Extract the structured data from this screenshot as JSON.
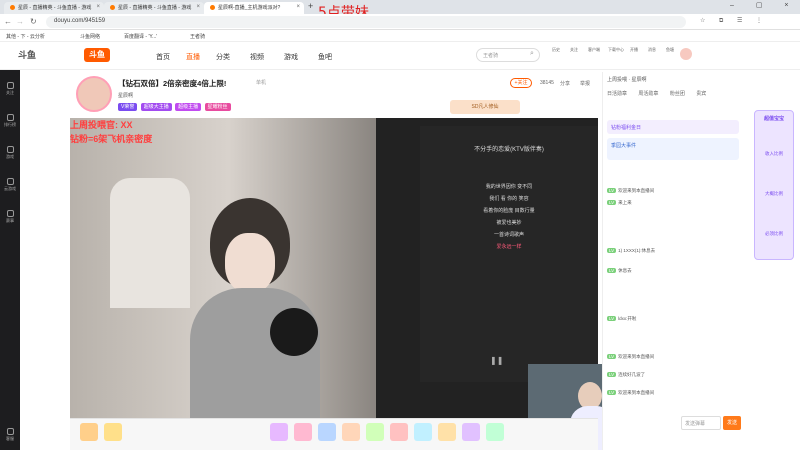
{
  "browser": {
    "tabs": [
      {
        "label": "星辰 - 直播精英 - 斗鱼直播 - 游戏"
      },
      {
        "label": "星辰 - 直播精英 - 斗鱼直播 - 游戏"
      },
      {
        "label": "星辰啊-直播_主机游戏派对?"
      }
    ],
    "url": "douyu.com/945159",
    "bookmarks": [
      "其他 - 下 - 云分析",
      "斗鱼网络",
      "百度翻译 - 'Y...'",
      "王者骑"
    ]
  },
  "overlay_text": "5点带妹",
  "site": {
    "logo": "斗鱼",
    "nav": [
      "首页",
      "直播",
      "分类",
      "视频",
      "游戏",
      "鱼吧"
    ],
    "search_placeholder": "王者骑",
    "header_icons": [
      "历史",
      "关注",
      "客户端",
      "下载中心",
      "开播",
      "消息",
      "鱼塘"
    ]
  },
  "rail": [
    "关注",
    "排行榜",
    "游戏",
    "云游戏",
    "赛事",
    "客服"
  ],
  "room": {
    "title": "【钻石双倍】2倍亲密度4倍上限!",
    "category": "单机",
    "sub": "星辰啊",
    "badges": [
      "V荣誉",
      "超级大主播",
      "超级主播",
      "星耀粉丝"
    ],
    "follow_label": "+关注",
    "fans_count": "38145",
    "share_label": "分享",
    "report_label": "举报",
    "sponsor": "SD凡人修仙"
  },
  "video": {
    "caption1": "上周投喂官: XX",
    "caption2": "钻粉=6架飞机亲密度",
    "music": {
      "title": "不分手的恋爱(KTV版伴奏)",
      "lines": [
        "我的世界因你 变不同",
        "我们 看 你的 笑容",
        "看着你的脸庞 目数行量",
        "被爱也美妙",
        "一首诗词歌声",
        "要永远一样"
      ],
      "active_line": "爱永远一样"
    }
  },
  "right_panel": {
    "tabs": [
      "日活勋章",
      "周活勋章",
      "粉丝团",
      "贵宾"
    ],
    "rank_title": "上周投喂",
    "rank_label": "星辰啊",
    "notices": [
      "钻粉福利金日",
      "季园大事件"
    ],
    "messages": [
      "欢迎来到本直播间",
      "来上来",
      "1) 1XXX(1):休息去",
      "休息去",
      "ldxx:开啦",
      "欢迎来到本直播间",
      "连续好几波了",
      "欢迎来到本直播间"
    ],
    "input_placeholder": "发送弹幕",
    "send_label": "发送"
  },
  "far_right": [
    "超值宝宝",
    "收入比例",
    "大概比例",
    "必须比例"
  ]
}
